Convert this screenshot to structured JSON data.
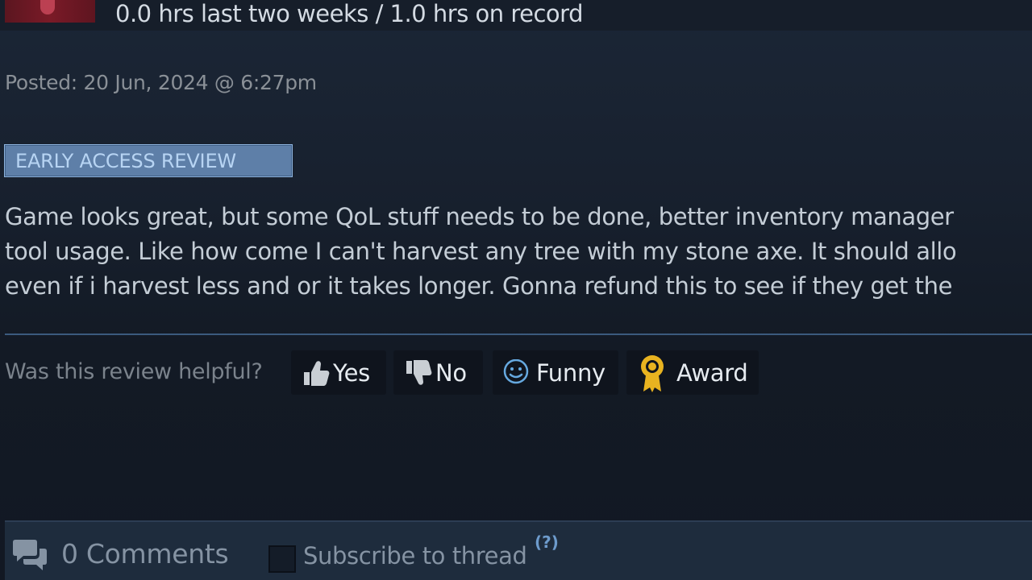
{
  "review": {
    "playtime": "0.0 hrs last two weeks / 1.0 hrs on record",
    "posted": "Posted: 20 Jun, 2024 @ 6:27pm",
    "badge": "EARLY ACCESS REVIEW",
    "text_lines": [
      "Game looks great, but some QoL stuff needs to be done, better inventory manager",
      "tool usage. Like how come I can't harvest any tree with my stone axe. It should allo",
      "even if i harvest less and or it takes longer. Gonna refund this to see if they get the"
    ]
  },
  "helpful": {
    "prompt": "Was this review helpful?",
    "yes_label": "Yes",
    "no_label": "No",
    "funny_label": "Funny",
    "award_label": "Award"
  },
  "comments": {
    "count_label": "0 Comments",
    "subscribe_label": "Subscribe to thread",
    "help_label": "(?)"
  },
  "icons": {
    "thumbs_up": "thumbs-up-icon",
    "thumbs_down": "thumbs-down-icon",
    "smiley": "smiley-icon",
    "award": "award-ribbon-icon",
    "comments": "speech-bubbles-icon"
  },
  "colors": {
    "badge_bg": "#5e7fa8",
    "badge_text": "#b7d4f3",
    "award_gold": "#e8b320",
    "funny_blue": "#66a9e0",
    "divider": "#3b5a7e"
  }
}
